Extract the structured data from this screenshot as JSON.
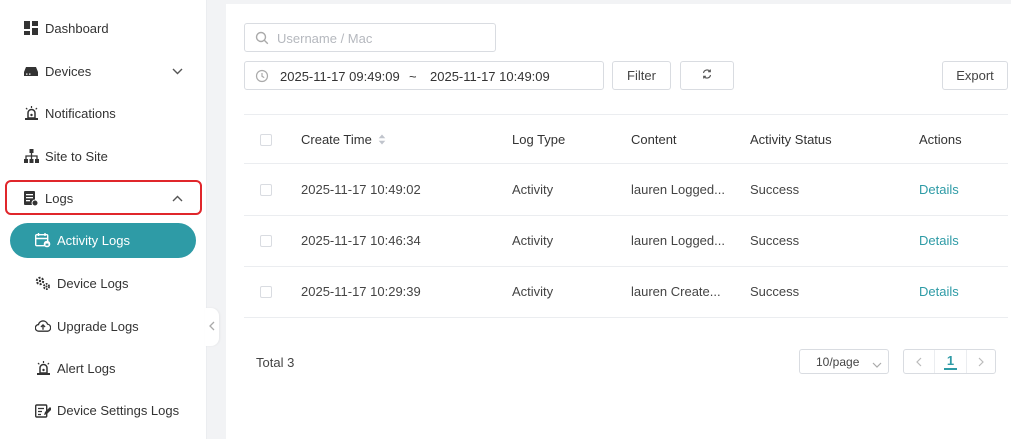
{
  "sidebar": {
    "items": [
      {
        "label": "Dashboard",
        "icon": "dashboard-icon"
      },
      {
        "label": "Devices",
        "icon": "devices-icon"
      },
      {
        "label": "Notifications",
        "icon": "bell-icon"
      },
      {
        "label": "Site to Site",
        "icon": "sitemap-icon"
      },
      {
        "label": "Logs",
        "icon": "logs-icon"
      }
    ],
    "sub_items": [
      {
        "label": "Activity Logs",
        "icon": "calendar-lock-icon",
        "active": true
      },
      {
        "label": "Device Logs",
        "icon": "gears-icon"
      },
      {
        "label": "Upgrade Logs",
        "icon": "cloud-upload-icon"
      },
      {
        "label": "Alert Logs",
        "icon": "alarm-icon"
      },
      {
        "label": "Device Settings Logs",
        "icon": "edit-list-icon"
      }
    ]
  },
  "toolbar": {
    "search_placeholder": "Username / Mac",
    "date_start": "2025-11-17 09:49:09",
    "date_sep": "~",
    "date_end": "2025-11-17 10:49:09",
    "filter_label": "Filter",
    "export_label": "Export"
  },
  "table": {
    "columns": [
      "Create Time",
      "Log Type",
      "Content",
      "Activity Status",
      "Actions"
    ],
    "rows": [
      {
        "time": "2025-11-17 10:49:02",
        "type": "Activity",
        "content": "lauren Logged...",
        "status": "Success",
        "action": "Details"
      },
      {
        "time": "2025-11-17 10:46:34",
        "type": "Activity",
        "content": "lauren Logged...",
        "status": "Success",
        "action": "Details"
      },
      {
        "time": "2025-11-17 10:29:39",
        "type": "Activity",
        "content": "lauren Create...",
        "status": "Success",
        "action": "Details"
      }
    ]
  },
  "footer": {
    "total": "Total 3",
    "page_size": "10/page",
    "current_page": "1"
  },
  "colors": {
    "accent": "#2e9ba6",
    "highlight_border": "#e0262b"
  }
}
